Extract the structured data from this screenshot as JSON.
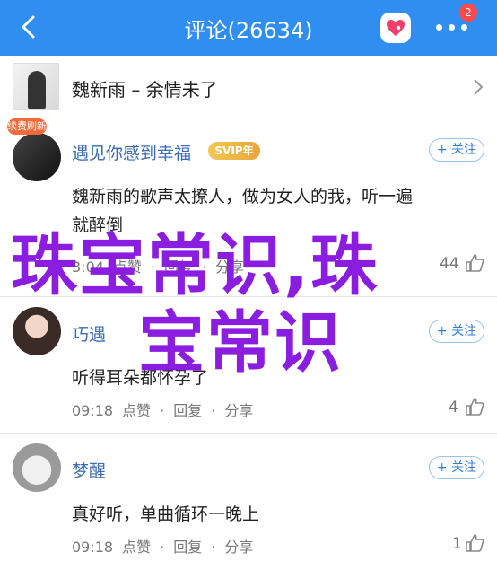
{
  "header": {
    "title": "评论(26634)",
    "notification_count": "2",
    "accent": "#2f8ef0"
  },
  "song": {
    "title": "魏新雨 – 余情未了"
  },
  "vip_badge": "续费刷新",
  "comments": [
    {
      "user": "遇见你感到幸福",
      "svip": "SVIP年",
      "follow": "+ 关注",
      "text1": "魏新雨的歌声太撩人，做为女人的我，听一遍",
      "text2": "就醉倒",
      "time": "3:04",
      "like_action": "点赞",
      "reply": "回复",
      "share": "分享",
      "likes": "44"
    },
    {
      "user": "巧遇",
      "follow": "+ 关注",
      "text1": "听得耳朵都怀孕了",
      "time": "09:18",
      "like_action": "点赞",
      "reply": "回复",
      "share": "分享",
      "likes": "4"
    },
    {
      "user": "梦醒",
      "follow": "+ 关注",
      "text1": "真好听，单曲循环一晚上",
      "time": "09:18",
      "like_action": "点赞",
      "reply": "回复",
      "share": "分享",
      "likes": "1"
    }
  ],
  "watermark": {
    "line1": "珠宝常识,珠",
    "line2": "宝常识"
  }
}
